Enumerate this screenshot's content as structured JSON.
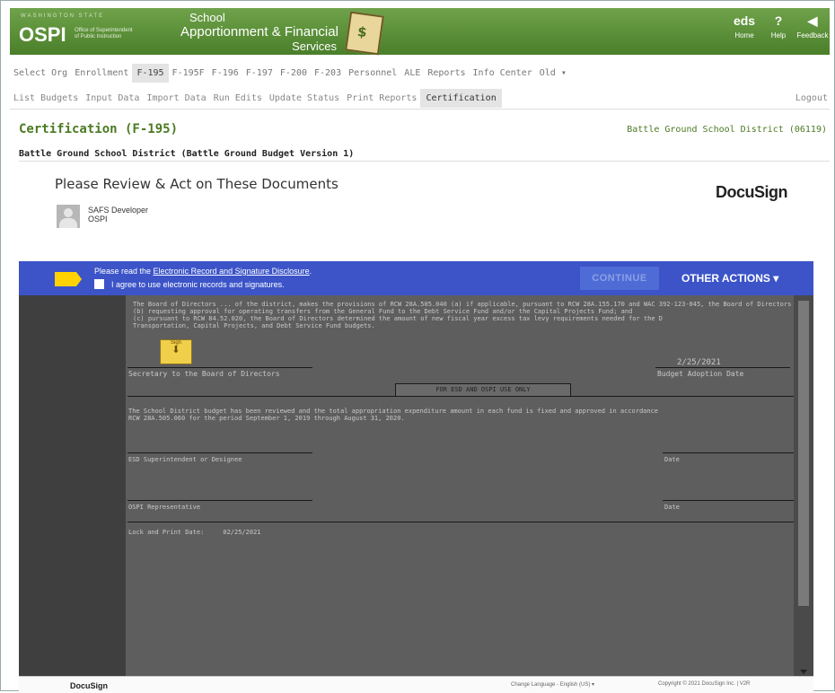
{
  "header": {
    "state_label": "WASHINGTON STATE",
    "org": "OSPI",
    "org_sub_1": "Office of Superintendent",
    "org_sub_2": "of Public Instruction",
    "app_title_1": "School",
    "app_title_2": "Apportionment & Financial",
    "app_title_3": "Services",
    "nav": [
      {
        "icon": "eds",
        "label": "Home"
      },
      {
        "icon": "?",
        "label": "Help"
      },
      {
        "icon": "◀",
        "label": "Feedback"
      }
    ]
  },
  "tabs_primary": [
    "Select Org",
    "Enrollment",
    "F-195",
    "F-195F",
    "F-196",
    "F-197",
    "F-200",
    "F-203",
    "Personnel",
    "ALE",
    "Reports",
    "Info Center",
    "Old ▾"
  ],
  "tabs_primary_active": "F-195",
  "tabs_secondary": [
    "List Budgets",
    "Input Data",
    "Import Data",
    "Run Edits",
    "Update Status",
    "Print Reports",
    "Certification"
  ],
  "tabs_secondary_active": "Certification",
  "logout": "Logout",
  "page_title": "Certification (F-195)",
  "district_label": "Battle Ground School District (06119)",
  "section_title": "Battle Ground School District (Battle Ground Budget Version 1)",
  "docusign": {
    "heading": "Please Review & Act on These Documents",
    "brand": "DocuSign",
    "sender_name": "SAFS Developer",
    "sender_org": "OSPI",
    "read_prefix": "Please read the ",
    "disclosure_link": "Electronic Record and Signature Disclosure",
    "read_suffix": ".",
    "agree_text": "I agree to use electronic records and signatures.",
    "continue_label": "CONTINUE",
    "other_actions_label": "OTHER ACTIONS ▾",
    "sign_label": "Sign"
  },
  "document": {
    "para_text": "The Board of Directors ... of the district, makes the provisions of RCW 28A.505.040 (a) if applicable, pursuant to RCW 28A.155.170 and WAC 392-123-045, the Board of Directors has executed a resolution as part of the Budget h\n(b) requesting approval for operating transfers from the General Fund to the Debt Service Fund and/or the Capital Projects Fund; and\n(c) pursuant to RCW 84.52.020, the Board of Directors determined the amount of new fiscal year excess tax levy requirements needed for the D\nTransportation, Capital Projects, and Debt Service Fund budgets.",
    "date": "2/25/2021",
    "secretary_label": "Secretary to the Board of Directors",
    "adoption_label": "Budget Adoption Date",
    "esd_box": "FOR ESD AND OSPI USE ONLY",
    "review_text": "The School District budget has been reviewed and the total appropriation expenditure amount in each fund is fixed and approved in accordance\nRCW 28A.505.060 for the period September 1, 2019 through August 31, 2020.",
    "esd_superintendent": "ESD Superintendent or Designee",
    "ospi_rep": "OSPI Representative",
    "date_label": "Date",
    "lock_print": "Lock and Print Date:     02/25/2021"
  },
  "footer": {
    "brand": "DocuSign",
    "language": "Change Language - English (US)  ▾",
    "copyright": "Copyright © 2021 DocuSign Inc. | V2R"
  },
  "colors": {
    "brand_green": "#4b7a23",
    "docusign_blue": "#3c54c8",
    "sign_yellow": "#f0cf4a"
  }
}
